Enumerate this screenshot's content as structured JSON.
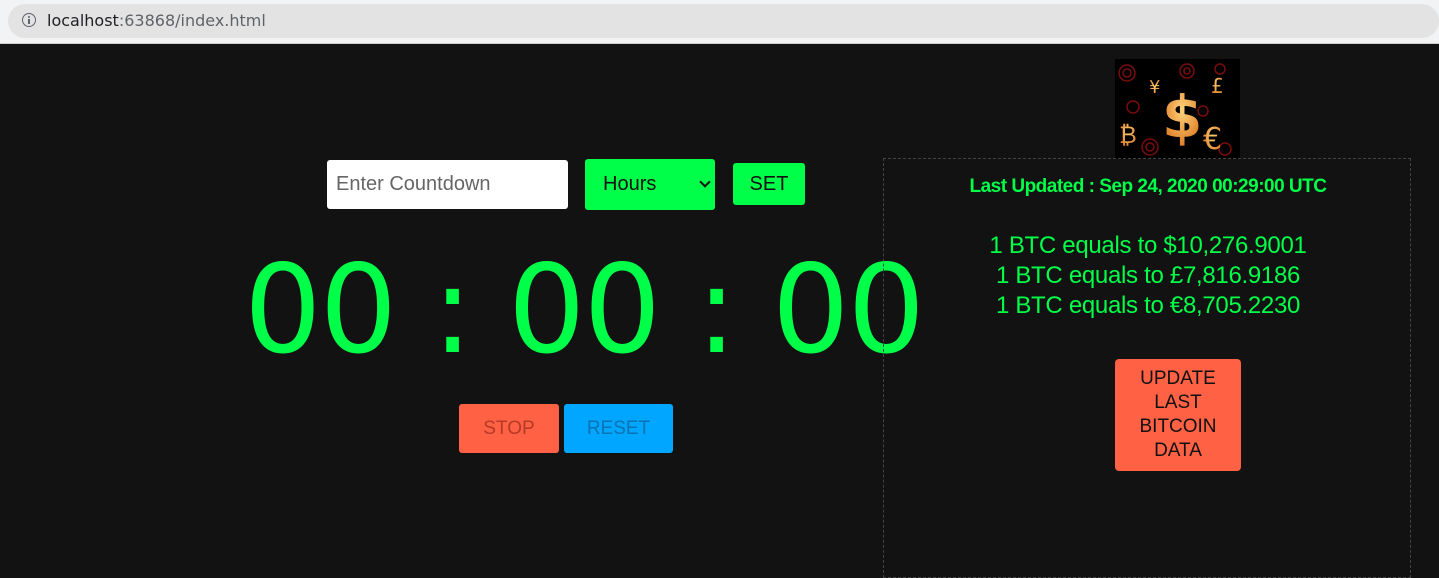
{
  "browser": {
    "url_host": "localhost",
    "url_rest": ":63868/index.html"
  },
  "countdown": {
    "input_placeholder": "Enter Countdown",
    "input_value": "",
    "unit_selected": "Hours",
    "set_label": "SET"
  },
  "timer": {
    "hours": "00",
    "minutes": "00",
    "seconds": "00",
    "separator": ":",
    "stop_label": "STOP",
    "reset_label": "RESET"
  },
  "bitcoin": {
    "last_updated": "Last Updated : Sep 24, 2020 00:29:00 UTC",
    "rates": [
      "1 BTC equals to $10,276.9001",
      "1 BTC equals to £7,816.9186",
      "1 BTC equals to €8,705.2230"
    ],
    "update_label": "UPDATE LAST BITCOIN DATA",
    "logo_symbols": [
      "¥",
      "$",
      "£",
      "₿",
      "€"
    ]
  },
  "colors": {
    "accent_green": "#00ff48",
    "stop_red": "#ff6145",
    "reset_blue": "#00a6ff",
    "background": "#121212"
  }
}
